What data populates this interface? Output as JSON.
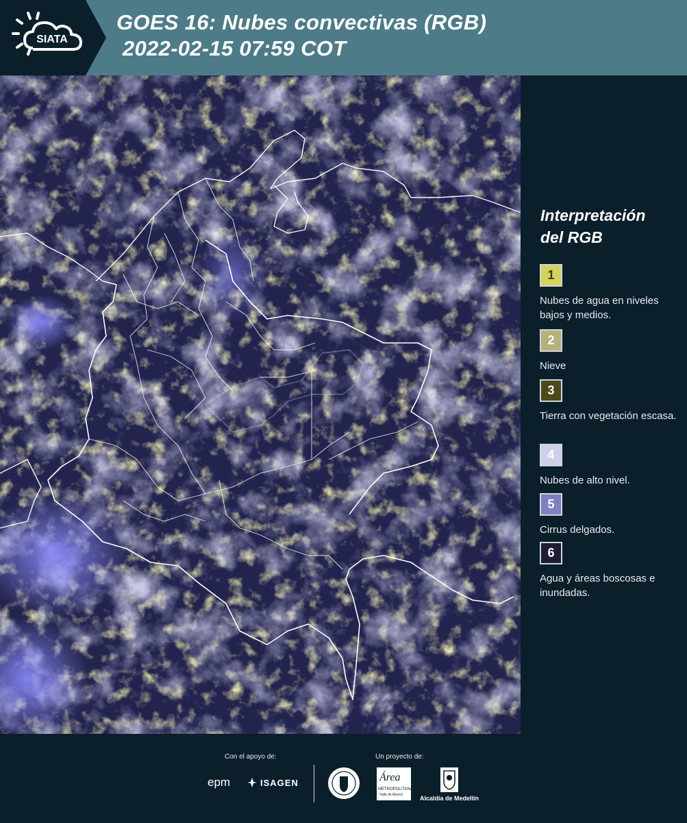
{
  "header": {
    "logo_text": "SIATA",
    "title_line1": "GOES 16: Nubes convectivas (RGB)",
    "title_line2": " 2022-02-15 07:59 COT"
  },
  "legend": {
    "title_line1": "Interpretación",
    "title_line2": "del RGB",
    "items": [
      {
        "number": "1",
        "color": "#d4d35c",
        "label": "Nubes de agua en niveles bajos y medios."
      },
      {
        "number": "2",
        "color": "#b2b27a",
        "label": "Nieve"
      },
      {
        "number": "3",
        "color": "#4d4a1a",
        "label": "Tierra con vegetación escasa."
      },
      {
        "number": "4",
        "color": "#cfcfee",
        "label": "Nubes de alto nivel."
      },
      {
        "number": "5",
        "color": "#7f7fc4",
        "label": "Cirrus delgados."
      },
      {
        "number": "6",
        "color": "#1d1c33",
        "label": "Agua y áreas boscosas e inundadas."
      }
    ]
  },
  "footer": {
    "support_caption": "Con el apoyo de:",
    "project_caption": "Un proyecto de:",
    "epm_text": "epm",
    "isagen_text": "ISAGEN",
    "area_text": "Área",
    "area_subtext": "METROPOLITANA",
    "area_subtext2": "Valle de Aburrá",
    "alcaldia_text": "Alcaldía de Medellín"
  }
}
